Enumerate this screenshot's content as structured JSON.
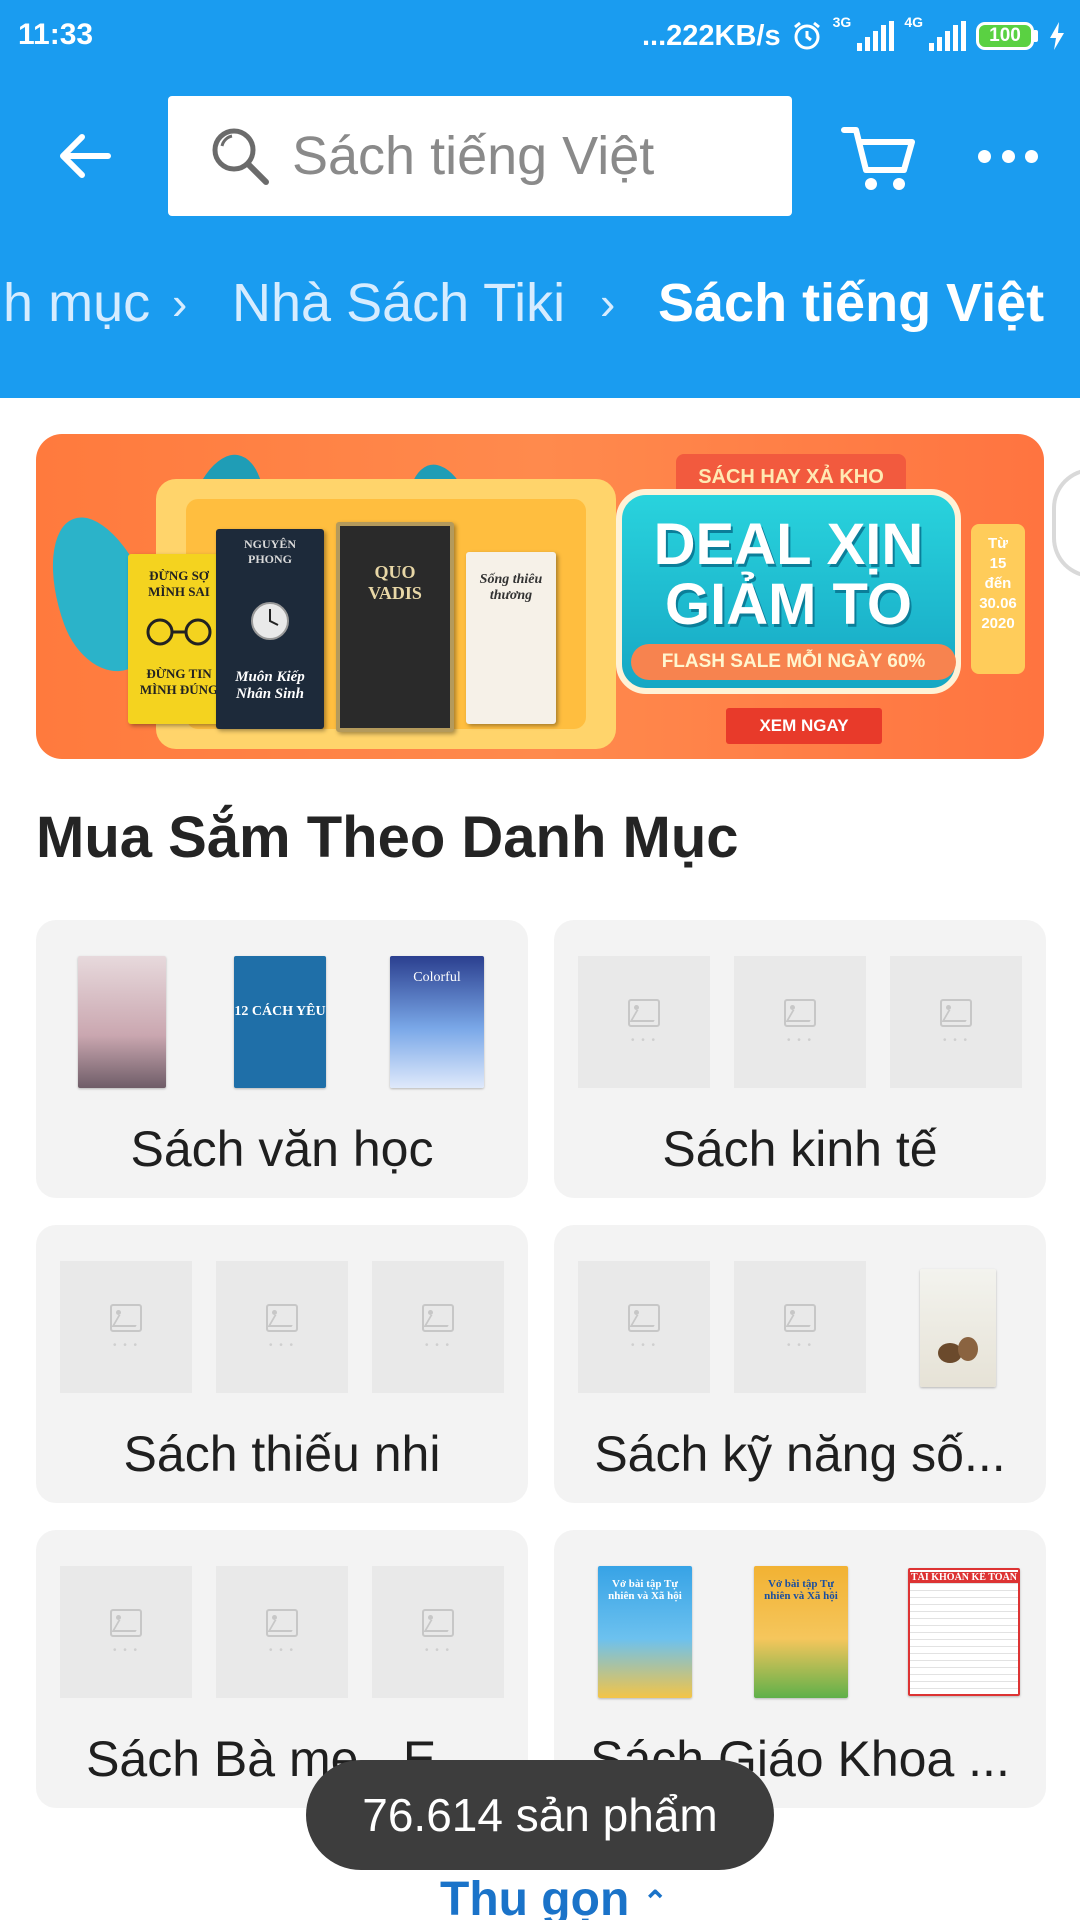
{
  "status_bar": {
    "time": "11:33",
    "speed": "...222KB/s",
    "net1": "3G",
    "net2": "4G",
    "battery": "100"
  },
  "search": {
    "placeholder": "Sách tiếng Việt"
  },
  "breadcrumb": [
    {
      "label": "Danh mục"
    },
    {
      "label": "Nhà Sách Tiki"
    },
    {
      "label": "Sách tiếng Việt"
    }
  ],
  "banner": {
    "ribbon": "SÁCH HAY XẢ KHO",
    "headline1": "DEAL XỊN",
    "headline2": "GIẢM TO",
    "flash": "FLASH SALE MỖI NGÀY 60%",
    "cta": "XEM NGAY",
    "date": [
      "Từ",
      "15",
      "đến",
      "30.06",
      "2020"
    ],
    "books": {
      "b1_title": "ĐỪNG SỢ MÌNH SAI",
      "b1_sub": "ĐỪNG TIN MÌNH ĐÚNG",
      "b2_author": "NGUYÊN PHONG",
      "b2_title": "Muôn Kiếp Nhân Sinh",
      "b3_title": "QUO VADIS",
      "b4_title": "Sống thiêu thương"
    }
  },
  "section": {
    "title": "Mua Sắm Theo Danh Mục"
  },
  "categories": [
    {
      "label": "Sách văn học"
    },
    {
      "label": "Sách kinh tế"
    },
    {
      "label": "Sách thiếu nhi"
    },
    {
      "label": "Sách kỹ năng số..."
    },
    {
      "label": "Sách Bà mẹ - E..."
    },
    {
      "label": "Sách Giáo Khoa ..."
    }
  ],
  "covers": {
    "c1": "12 CÁCH YÊU",
    "c2": "Colorful",
    "c3": "Vở bài tập Tự nhiên và Xã hội",
    "c4": "Vở bài tập Tự nhiên và Xã hội",
    "c5": "TÀI KHOẢN KẾ TOÁN"
  },
  "toast": "76.614 sản phẩm",
  "collapse_label": "Thu gọn",
  "colors": {
    "header": "#1a9cf0",
    "accent_link": "#1a73c9",
    "card_bg": "#f3f3f3"
  },
  "icons": [
    "back-arrow-icon",
    "search-icon",
    "cart-icon",
    "more-icon",
    "chevron-right-icon",
    "chevron-up-icon",
    "alarm-icon",
    "signal-icon",
    "battery-icon",
    "charging-icon",
    "image-placeholder-icon"
  ]
}
